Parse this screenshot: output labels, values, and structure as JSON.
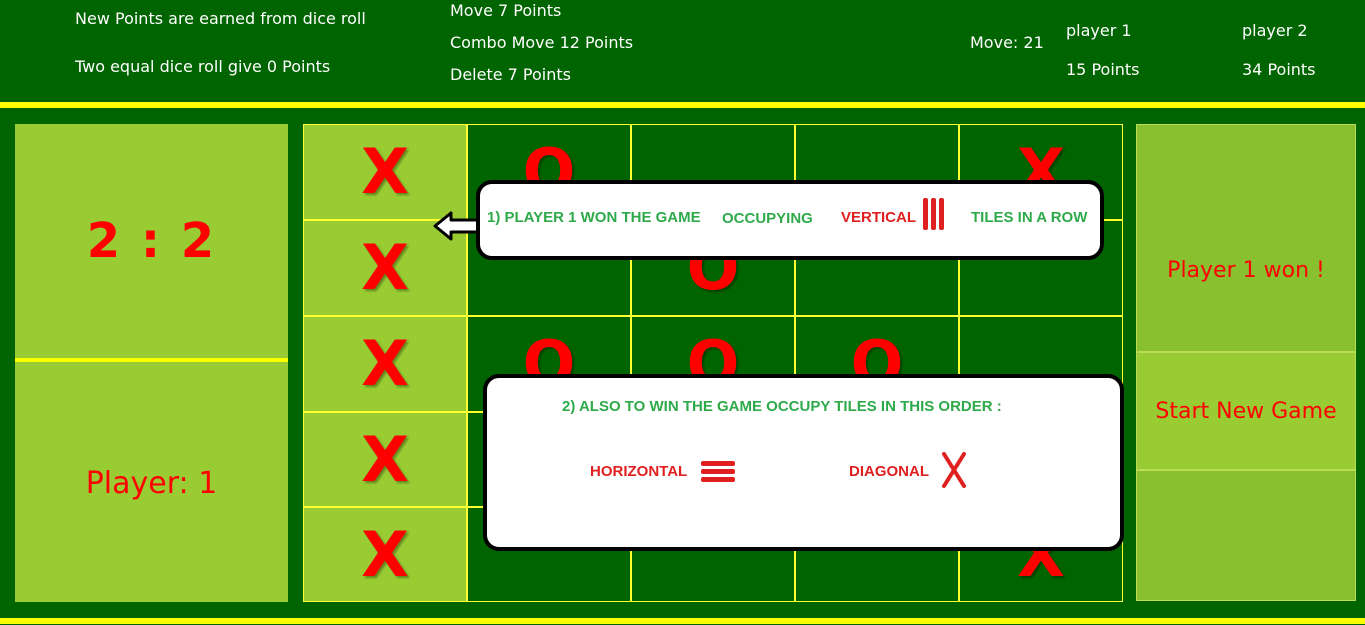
{
  "header": {
    "rule1": "New Points are earned from dice roll",
    "rule2": "Two equal dice roll give 0 Points",
    "move_points": "Move 7 Points",
    "combo_points": "Combo Move 12 Points",
    "delete_points": "Delete 7 Points",
    "move_count": "Move: 21",
    "player1_name": "player 1",
    "player1_points": "15 Points",
    "player2_name": "player 2",
    "player2_points": "34 Points"
  },
  "dice": {
    "value": "2 : 2"
  },
  "current_player": "Player: 1",
  "board": {
    "rows": [
      [
        "X",
        "O",
        "",
        "",
        "X"
      ],
      [
        "X",
        "",
        "O",
        "",
        ""
      ],
      [
        "X",
        "O",
        "O",
        "O",
        ""
      ],
      [
        "X",
        "",
        "",
        "",
        ""
      ],
      [
        "X",
        "",
        "",
        "",
        "X"
      ]
    ]
  },
  "status": {
    "winner": "Player 1 won !",
    "new_game": "Start New Game"
  },
  "tooltip1": {
    "text": "1) PLAYER 1 WON THE GAME",
    "occupying": "OCCUPYING",
    "vertical": "VERTICAL",
    "tiles": "TILES IN A ROW"
  },
  "tooltip2": {
    "text": "2) ALSO TO WIN THE GAME OCCUPY TILES IN THIS ORDER :",
    "horizontal": "HORIZONTAL",
    "diagonal": "DIAGONAL"
  },
  "colors": {
    "background": "#006400",
    "panel": "#99cc33",
    "accent_line": "#ffff00",
    "mark": "#ff0000",
    "tip_green": "#2eaa4a",
    "tip_red": "#e02020"
  }
}
